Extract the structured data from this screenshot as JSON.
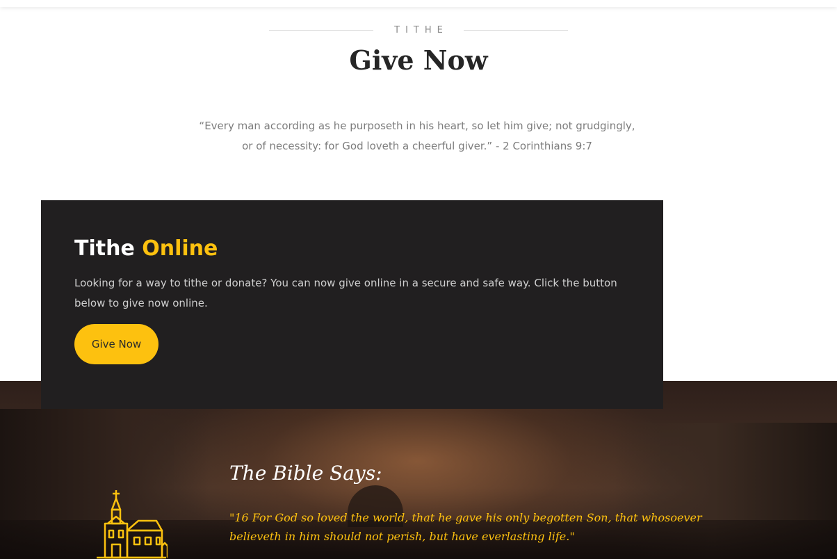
{
  "section": {
    "eyebrow": "TITHE",
    "title": "Give Now",
    "verse": "“Every man according as he purposeth in his heart, so let him give; not grudgingly, or of necessity: for God loveth a cheerful giver.” - 2 Corinthians 9:7"
  },
  "card": {
    "title_main": "Tithe",
    "title_accent": "Online",
    "text": "Looking for a way to tithe or donate? You can now give online in a secure and safe way. Click the button below to give now online.",
    "button_label": "Give Now"
  },
  "banner": {
    "heading": "The Bible Says:",
    "quote": "\"16 For God so loved the world, that he gave his only begotten Son, that whosoever believeth in him should not perish, but have everlasting life.\"",
    "icon": "church-icon"
  },
  "colors": {
    "accent": "#fdc10f",
    "card_bg": "#211f20",
    "title_text": "#262626",
    "muted_text": "#7c7c7c"
  }
}
